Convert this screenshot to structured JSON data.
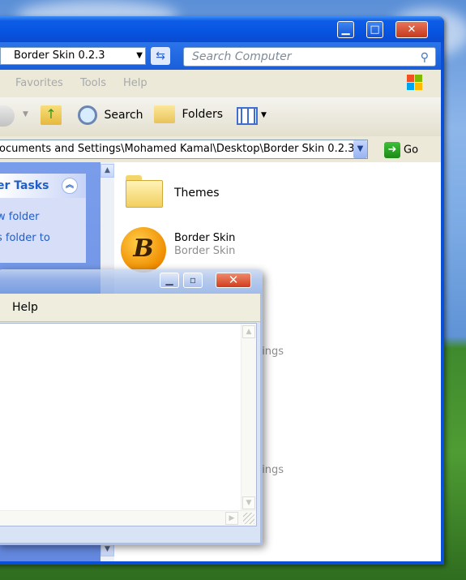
{
  "explorer": {
    "location_combo": "Border Skin 0.2.3",
    "search_placeholder": "Search Computer",
    "menus": [
      "Favorites",
      "Tools",
      "Help"
    ],
    "toolbar": {
      "search": "Search",
      "folders": "Folders"
    },
    "address_path": "ocuments and Settings\\Mohamed Kamal\\Desktop\\Border Skin 0.2.3",
    "go_label": "Go",
    "tasks": {
      "header": "er Tasks",
      "links": [
        "w folder",
        "s folder to"
      ]
    },
    "files": [
      {
        "name": "Themes",
        "icon": "folder-icon"
      },
      {
        "name": "Border Skin",
        "subtitle": "Border Skin",
        "icon": "border-skin-app-icon"
      }
    ],
    "partial_text": [
      "ttings",
      "ttings"
    ]
  },
  "dialog": {
    "menu": [
      "Help"
    ]
  },
  "colors": {
    "xp_blue": "#0a4fd8",
    "task_link": "#215dc6",
    "close_red": "#d03c1d"
  }
}
